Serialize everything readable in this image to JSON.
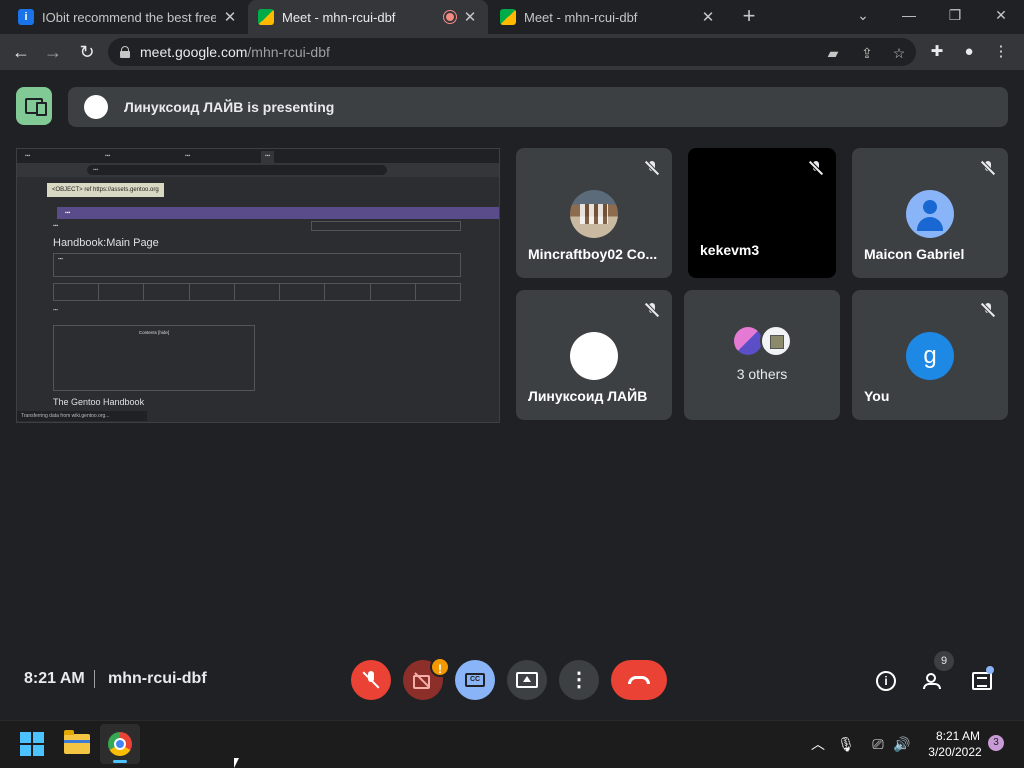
{
  "browser": {
    "tabs": [
      {
        "title": "IObit recommend the best free, f",
        "favicon": "iobit-icon"
      },
      {
        "title": "Meet - mhn-rcui-dbf",
        "favicon": "meet-icon",
        "active": true,
        "recording": true
      },
      {
        "title": "Meet - mhn-rcui-dbf",
        "favicon": "meet-icon"
      }
    ],
    "new_tab": "+",
    "window_controls": {
      "chevron": "⌄",
      "minimize": "—",
      "restore": "❐",
      "close": "✕"
    },
    "url_host": "meet.google.com",
    "url_path": "/mhn-rcui-dbf",
    "nav": {
      "back": "←",
      "forward": "→",
      "reload": "↻"
    }
  },
  "meet": {
    "presenting_text": "Линуксоид ЛАЙВ is presenting",
    "shared_screen": {
      "object_tooltip": "<OBJECT> ref https://assets.gentoo.org",
      "page_heading": "Handbook:Main Page",
      "section_heading": "The Gentoo Handbook",
      "status_text": "Transferring data from wiki.gentoo.org...",
      "contents_title": "Contents [hide]"
    },
    "participants": [
      {
        "name": "Mincraftboy02 Co...",
        "avatar": "minecraft-avatar"
      },
      {
        "name": "kekevm3",
        "avatar": "none"
      },
      {
        "name": "Maicon Gabriel",
        "avatar": "default-person-avatar"
      },
      {
        "name": "Линуксоид ЛАЙВ",
        "avatar": "white-avatar"
      },
      {
        "name": "3 others",
        "avatar": "group-avatar"
      },
      {
        "name": "You",
        "avatar_letter": "g"
      }
    ],
    "time": "8:21 AM",
    "meeting_code": "mhn-rcui-dbf",
    "controls": {
      "camera_warning": "!",
      "cc_label": "CC",
      "more": "⋮",
      "info": "i",
      "people_count": "9"
    },
    "colors": {
      "background": "#202124",
      "tile": "#3c4043",
      "end_call": "#ea4335",
      "accent_blue": "#8ab4f8"
    }
  },
  "taskbar": {
    "clock_time": "8:21 AM",
    "clock_date": "3/20/2022",
    "notification_count": "3",
    "tray": {
      "chevron": "︿",
      "mic": "🎙",
      "network": "⎚",
      "volume": "🔊"
    }
  }
}
